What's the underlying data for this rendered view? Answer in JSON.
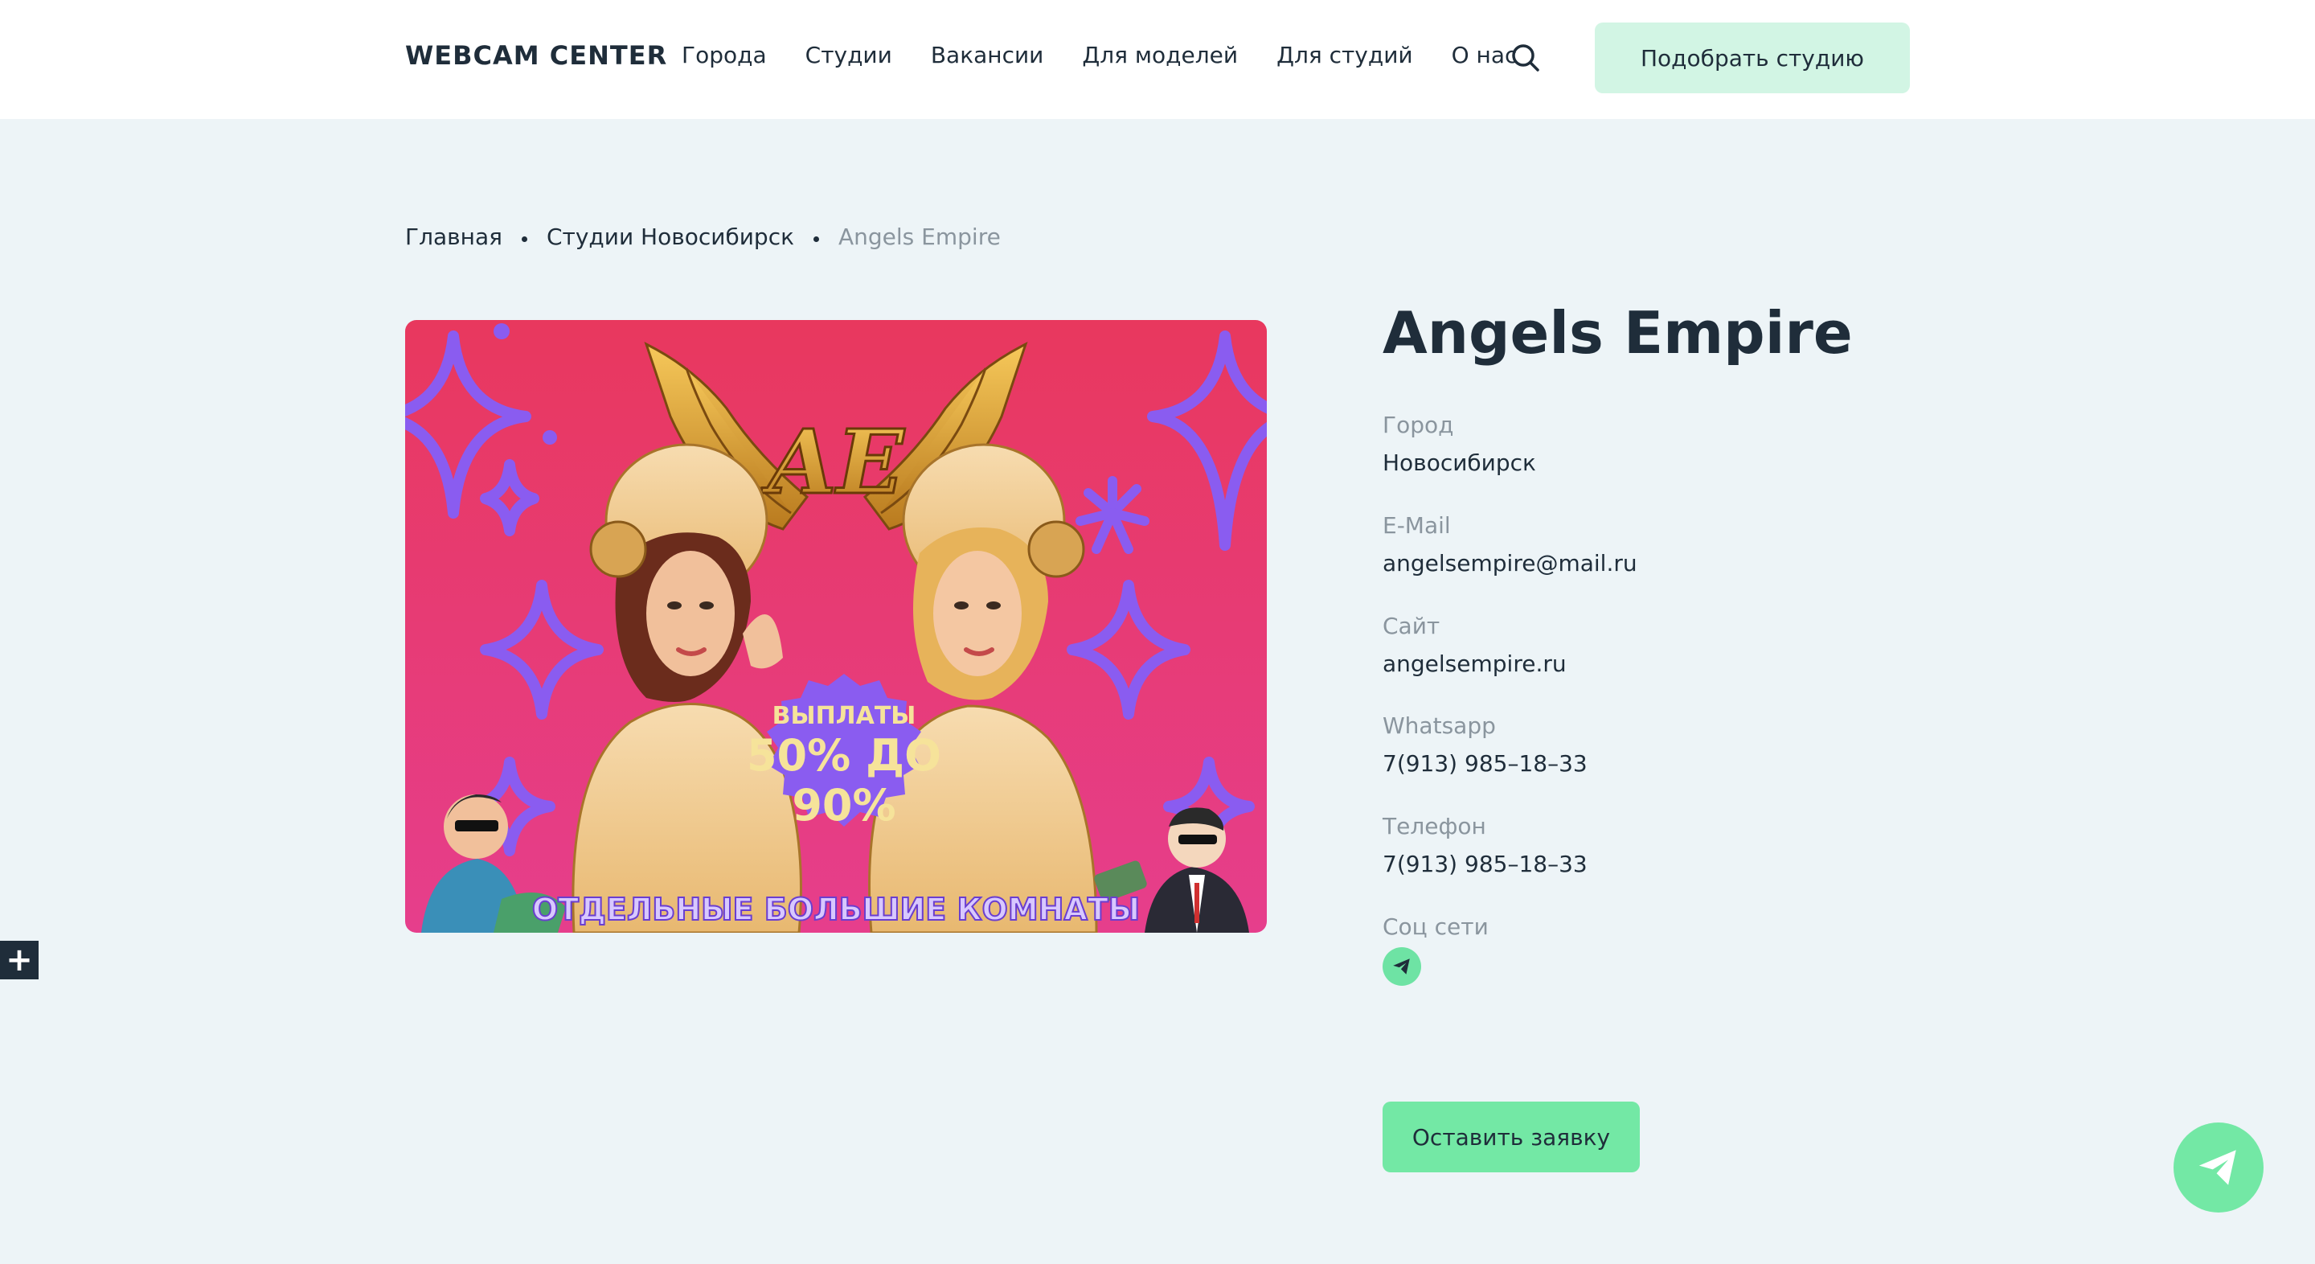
{
  "header": {
    "logo": "WEBCAM CENTER",
    "nav": [
      "Города",
      "Студии",
      "Вакансии",
      "Для моделей",
      "Для студий",
      "О нас"
    ],
    "cta": "Подобрать студию",
    "search_icon": "search-icon"
  },
  "breadcrumb": {
    "items": [
      "Главная",
      "Студии Новосибирск"
    ],
    "current": "Angels Empire"
  },
  "hero": {
    "monogram": "AE",
    "badge_top": "ВЫПЛАТЫ",
    "badge_line1": "50% ДО",
    "badge_line2": "90%",
    "banner": "ОТДЕЛЬНЫЕ БОЛЬШИЕ КОМНАТЫ"
  },
  "studio": {
    "title": "Angels Empire",
    "fields": [
      {
        "label": "Город",
        "value": "Новосибирск"
      },
      {
        "label": "E-Mail",
        "value": "angelsempire@mail.ru"
      },
      {
        "label": "Сайт",
        "value": "angelsempire.ru"
      },
      {
        "label": "Whatsapp",
        "value": "7(913) 985–18–33"
      },
      {
        "label": "Телефон",
        "value": "7(913) 985–18–33"
      }
    ],
    "social_label": "Соц сети",
    "social_icon": "telegram-icon",
    "apply": "Оставить заявку"
  },
  "colors": {
    "accent": "#73e8a5",
    "accent_light": "#d2f5e4",
    "background": "#edf4f7",
    "text": "#1f2d3a",
    "muted": "#8a959e"
  }
}
